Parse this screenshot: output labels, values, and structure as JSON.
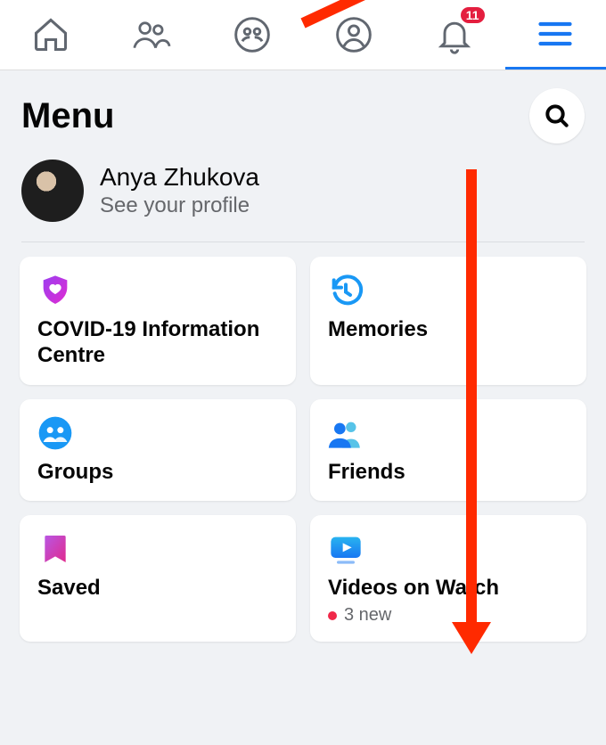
{
  "nav": {
    "badge_count": "11"
  },
  "header": {
    "title": "Menu"
  },
  "profile": {
    "name": "Anya Zhukova",
    "sub": "See your profile"
  },
  "cards": {
    "covid": {
      "label": "COVID-19 Information Centre"
    },
    "memories": {
      "label": "Memories"
    },
    "groups": {
      "label": "Groups"
    },
    "friends": {
      "label": "Friends"
    },
    "saved": {
      "label": "Saved"
    },
    "videos": {
      "label": "Videos on Watch",
      "meta": "3 new"
    }
  }
}
